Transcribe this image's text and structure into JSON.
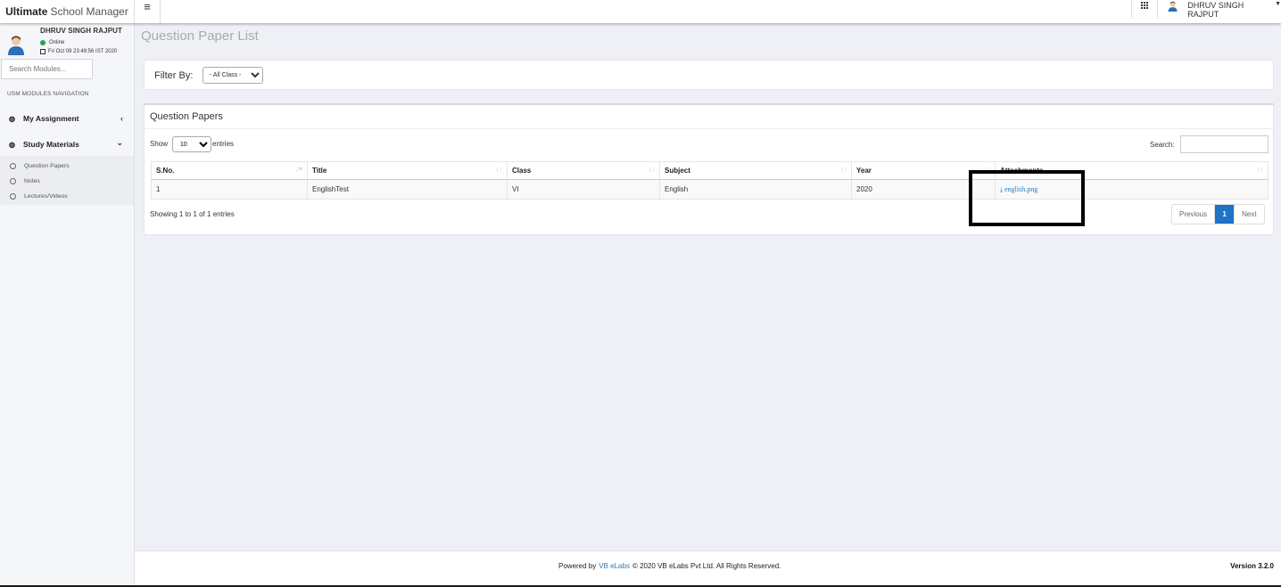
{
  "app": {
    "brand_bold": "Ultimate",
    "brand_light": "School Manager",
    "hamburger_icon": "≡"
  },
  "topbar": {
    "user_name": "DHRUV SINGH RAJPUT"
  },
  "sidebar": {
    "user_name": "DHRUV SINGH RAJPUT",
    "status": "Online",
    "datetime": "Fri Oct 09 23:49:56 IST 2020",
    "search_placeholder": "Search Modules...",
    "nav_header": "USM MODULES NAVIGATION",
    "items": [
      {
        "label": "My Assignment",
        "icon": "dashboard-icon",
        "arrow": "‹"
      },
      {
        "label": "Study Materials",
        "icon": "dashboard-icon",
        "arrow": "⌄"
      }
    ],
    "sub_items": [
      {
        "label": "Question Papers"
      },
      {
        "label": "Notes"
      },
      {
        "label": "Lectures/Videos"
      }
    ]
  },
  "main": {
    "page_title": "Question Paper List",
    "filter_label": "Filter By:",
    "filter_selected": "- All Class -",
    "card_title": "Question Papers",
    "show_label": "Show",
    "entries_selected": "10",
    "entries_label": "entries",
    "search_label": "Search:",
    "columns": [
      "S.No.",
      "Title",
      "Class",
      "Subject",
      "Year",
      "Attachments"
    ],
    "rows": [
      {
        "sno": "1",
        "title": "EnglishTest",
        "class": "VI",
        "subject": "English",
        "year": "2020",
        "attachment": "english.png"
      }
    ],
    "info_text": "Showing 1 to 1 of 1 entries",
    "pager": {
      "previous": "Previous",
      "page": "1",
      "next": "Next"
    }
  },
  "footer": {
    "powered_by": "Powered by",
    "link": "VB eLabs",
    "copyright": "© 2020 VB eLabs Pvt Ltd. All Rights Reserved.",
    "version": "Version 3.2.0"
  },
  "colors": {
    "accent": "#1f73c4",
    "link": "#2a7ab8",
    "online": "#28a745",
    "background": "#eef0f5"
  }
}
